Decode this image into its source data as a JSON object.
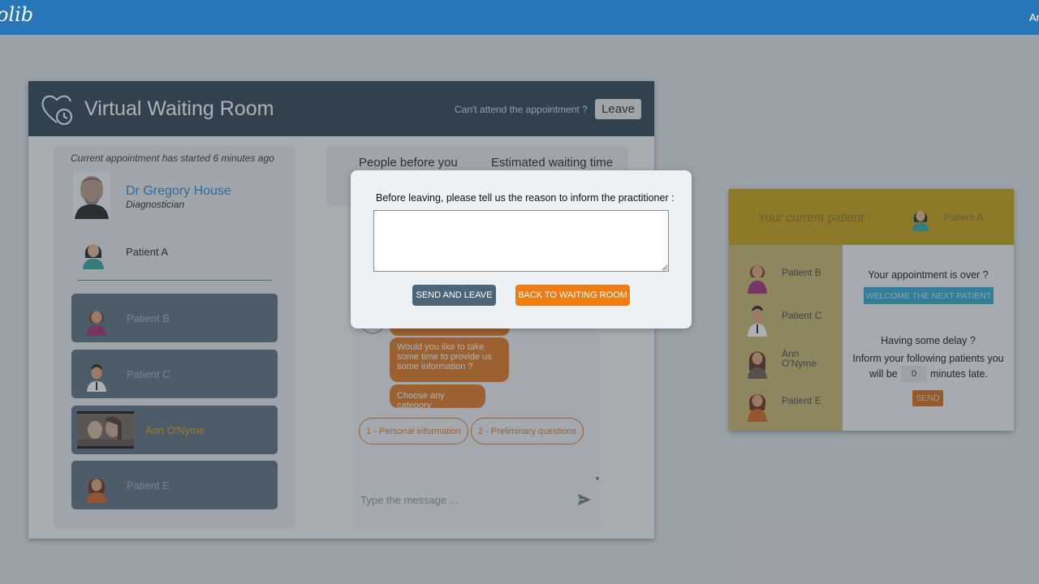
{
  "topbar": {
    "logo": "olib",
    "user": "An"
  },
  "waiting_room": {
    "title": "Virtual Waiting Room",
    "cant_attend": "Can't attend the appointment ?",
    "leave_label": "Leave",
    "started": "Current appointment has started 6 minutes ago",
    "doctor": {
      "name": "Dr Gregory House",
      "specialty": "Diagnostician"
    },
    "current_patient": "Patient A",
    "queue": [
      {
        "name": "Patient B",
        "active": false
      },
      {
        "name": "Patient C",
        "active": false
      },
      {
        "name": "Ann O'Nyme",
        "active": true
      },
      {
        "name": "Patient E",
        "active": false
      }
    ],
    "info": {
      "people_before": "People before you",
      "estimated": "Estimated waiting time"
    },
    "chat": {
      "bubble_question": "Would you like to take some time to provide us some information ?",
      "bubble_category": "Choose any category",
      "chips": [
        "1 - Personal information",
        "2 - Preliminary questions"
      ],
      "input_placeholder": "Type the message ..."
    }
  },
  "modal": {
    "text": "Before leaving, please tell us the reason to inform the practitioner :",
    "textarea_value": "",
    "send_label": "SEND AND LEAVE",
    "back_label": "BACK TO WAITING ROOM"
  },
  "practitioner": {
    "current_label": "Your current patient :",
    "current_patient": "Patient A",
    "list": [
      "Patient B",
      "Patient C",
      "Ann O'Nyme",
      "Patient E"
    ],
    "over_question": "Your appointment is over ?",
    "welcome_label": "WELCOME THE NEXT PATIENT",
    "delay_question": "Having some delay ?",
    "inform_text": "Inform your following patients you",
    "will_be": "will be",
    "minutes_value": "0",
    "minutes_late": "minutes late.",
    "send_label": "SEND"
  },
  "colors": {
    "topbar": "#2777b8",
    "header": "#2c3e4f",
    "accent_orange": "#f07c12",
    "accent_blue": "#2aa9ce",
    "practitioner_gold": "#c7a10d"
  }
}
